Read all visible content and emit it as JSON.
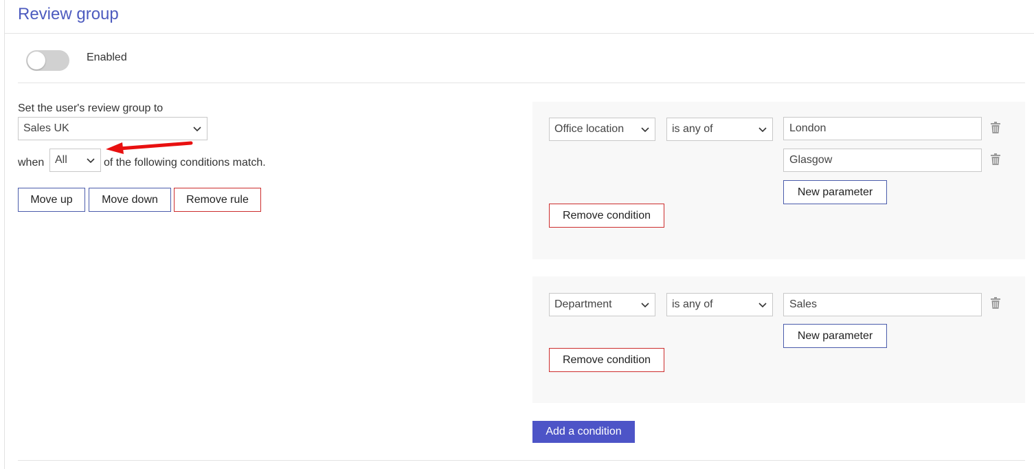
{
  "page": {
    "title": "Review group",
    "enabled_label": "Enabled"
  },
  "rule": {
    "set_label": "Set the user's review group to",
    "group_value": "Sales UK",
    "when_label": "when",
    "match_value": "All",
    "conditions_suffix": "of the following conditions match.",
    "move_up": "Move up",
    "move_down": "Move down",
    "remove_rule": "Remove rule"
  },
  "conditions": [
    {
      "field": "Office location",
      "operator": "is any of",
      "params": [
        "London",
        "Glasgow"
      ],
      "new_param": "New parameter",
      "remove": "Remove condition"
    },
    {
      "field": "Department",
      "operator": "is any of",
      "params": [
        "Sales"
      ],
      "new_param": "New parameter",
      "remove": "Remove condition"
    }
  ],
  "add_condition": "Add a condition",
  "colors": {
    "title": "#4d5bbf",
    "primary": "#4d54c7",
    "outline_blue": "#4a5bab",
    "outline_red": "#cc2b2b",
    "annotation_arrow": "#e81010",
    "panel_bg": "#f8f8f8"
  }
}
